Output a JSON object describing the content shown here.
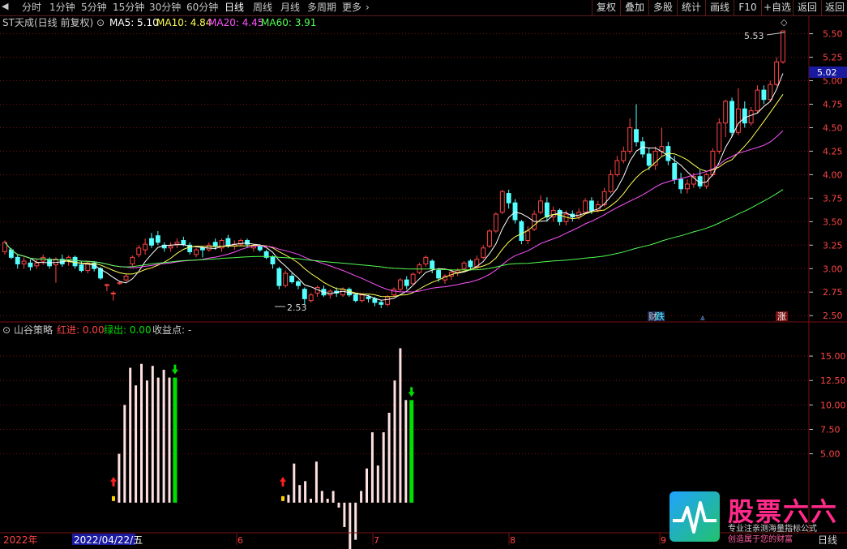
{
  "toolbar": {
    "nav_left_icon": "triangle-left-icon",
    "periods": [
      "分时",
      "1分钟",
      "5分钟",
      "15分钟",
      "30分钟",
      "60分钟",
      "日线",
      "周线",
      "月线",
      "多周期",
      "更多"
    ],
    "active_period": "日线",
    "more_icon": "chevron-right-icon",
    "buttons": [
      "复权",
      "叠加",
      "多股",
      "统计",
      "画线",
      "F10",
      "+自选",
      "返回"
    ]
  },
  "price_info": {
    "stock_title": "ST天成(日线 前复权)",
    "ma5": "MA5: 5.10",
    "ma10": "MA10: 4.84",
    "ma20": "MA20: 4.45",
    "ma60": "MA60: 3.91"
  },
  "price_axis": {
    "ticks": [
      "5.50",
      "5.25",
      "5.00",
      "4.75",
      "4.50",
      "4.25",
      "4.00",
      "3.75",
      "3.50",
      "3.25",
      "3.00",
      "2.75",
      "2.50"
    ],
    "current_price": "5.02",
    "high_label": "5.53",
    "low_label": "2.53"
  },
  "event_labels": {
    "cai": "财",
    "die": "跌",
    "zhang": "涨"
  },
  "indicator": {
    "name": "山谷策略",
    "red_in": "红进: 0.00",
    "green_out": "绿出: 0.00",
    "profit": "收益点: -",
    "ticks": [
      "15.00",
      "12.50",
      "10.00",
      "7.50",
      "5.00"
    ]
  },
  "time_axis": {
    "year": "2022年",
    "cursor_date": "2022/04/22/五",
    "months": [
      "6",
      "7",
      "8",
      "9"
    ]
  },
  "brand": {
    "name": "股票六六",
    "slogan1": "专业注亲测海量指标公式",
    "slogan2": "创造属于您的财富",
    "period": "日线"
  },
  "colors": {
    "up": "#ff4545",
    "down": "#54ffff",
    "ma5": "#ffffff",
    "ma10": "#ffff54",
    "ma20": "#ff54ff",
    "ma60": "#54ff54",
    "grid": "#7a1010",
    "signal_green": "#00e000"
  },
  "chart_data": {
    "type": "candlestick",
    "ylim": [
      2.45,
      5.6
    ],
    "candles": [
      [
        3.18,
        3.28,
        3.15,
        3.3
      ],
      [
        3.2,
        3.12,
        3.1,
        3.22
      ],
      [
        3.12,
        3.05,
        3.0,
        3.15
      ],
      [
        3.05,
        3.08,
        3.0,
        3.12
      ],
      [
        3.06,
        3.02,
        2.98,
        3.1
      ],
      [
        3.03,
        3.06,
        3.0,
        3.1
      ],
      [
        3.08,
        3.12,
        3.04,
        3.15
      ],
      [
        3.1,
        3.03,
        3.0,
        3.12
      ],
      [
        3.04,
        3.1,
        2.85,
        3.12
      ],
      [
        3.1,
        3.05,
        3.02,
        3.15
      ],
      [
        3.08,
        3.12,
        3.03,
        3.14
      ],
      [
        3.12,
        3.03,
        3.0,
        3.14
      ],
      [
        3.04,
        2.98,
        2.96,
        3.08
      ],
      [
        2.98,
        3.06,
        2.95,
        3.08
      ],
      [
        3.06,
        3.0,
        2.97,
        3.08
      ],
      [
        3.0,
        2.9,
        2.88,
        3.02
      ],
      [
        2.82,
        2.83,
        2.76,
        2.84
      ],
      [
        2.74,
        2.74,
        2.66,
        2.76
      ],
      [
        2.84,
        2.85,
        2.83,
        2.86
      ],
      [
        2.88,
        2.92,
        2.86,
        2.94
      ],
      [
        3.05,
        3.12,
        3.02,
        3.14
      ],
      [
        3.15,
        3.22,
        3.12,
        3.25
      ],
      [
        3.2,
        3.26,
        3.15,
        3.32
      ],
      [
        3.32,
        3.25,
        3.22,
        3.38
      ],
      [
        3.35,
        3.28,
        3.25,
        3.4
      ],
      [
        3.25,
        3.22,
        3.18,
        3.28
      ],
      [
        3.22,
        3.24,
        3.18,
        3.28
      ],
      [
        3.26,
        3.28,
        3.22,
        3.32
      ],
      [
        3.3,
        3.26,
        3.24,
        3.34
      ],
      [
        3.25,
        3.18,
        3.15,
        3.28
      ],
      [
        3.15,
        3.2,
        3.12,
        3.22
      ],
      [
        3.22,
        3.2,
        3.12,
        3.24
      ],
      [
        3.2,
        3.25,
        3.18,
        3.28
      ],
      [
        3.28,
        3.24,
        3.2,
        3.32
      ],
      [
        3.22,
        3.3,
        3.18,
        3.32
      ],
      [
        3.32,
        3.24,
        3.22,
        3.36
      ],
      [
        3.24,
        3.26,
        3.2,
        3.3
      ],
      [
        3.26,
        3.3,
        3.24,
        3.32
      ],
      [
        3.3,
        3.26,
        3.22,
        3.32
      ],
      [
        3.22,
        3.24,
        3.18,
        3.26
      ],
      [
        3.24,
        3.2,
        3.18,
        3.26
      ],
      [
        3.18,
        3.12,
        3.1,
        3.2
      ],
      [
        3.12,
        3.05,
        3.0,
        3.14
      ],
      [
        3.0,
        2.82,
        2.78,
        3.02
      ],
      [
        2.82,
        2.95,
        2.8,
        2.98
      ],
      [
        2.92,
        2.86,
        2.84,
        2.95
      ],
      [
        2.86,
        2.82,
        2.78,
        2.88
      ],
      [
        2.78,
        2.68,
        2.62,
        2.8
      ],
      [
        2.66,
        2.72,
        2.64,
        2.74
      ],
      [
        2.74,
        2.8,
        2.7,
        2.82
      ],
      [
        2.78,
        2.72,
        2.7,
        2.82
      ],
      [
        2.72,
        2.76,
        2.68,
        2.78
      ],
      [
        2.76,
        2.74,
        2.7,
        2.8
      ],
      [
        2.72,
        2.78,
        2.7,
        2.8
      ],
      [
        2.78,
        2.72,
        2.7,
        2.8
      ],
      [
        2.72,
        2.66,
        2.64,
        2.74
      ],
      [
        2.66,
        2.72,
        2.64,
        2.74
      ],
      [
        2.7,
        2.68,
        2.64,
        2.72
      ],
      [
        2.68,
        2.64,
        2.6,
        2.7
      ],
      [
        2.64,
        2.62,
        2.58,
        2.66
      ],
      [
        2.62,
        2.7,
        2.6,
        2.72
      ],
      [
        2.72,
        2.78,
        2.7,
        2.8
      ],
      [
        2.78,
        2.88,
        2.76,
        2.9
      ],
      [
        2.88,
        2.82,
        2.78,
        2.92
      ],
      [
        2.84,
        2.94,
        2.82,
        2.96
      ],
      [
        2.96,
        3.04,
        2.94,
        3.06
      ],
      [
        3.05,
        3.12,
        3.02,
        3.14
      ],
      [
        3.08,
        3.0,
        2.95,
        3.1
      ],
      [
        2.98,
        2.9,
        2.86,
        3.0
      ],
      [
        2.88,
        2.92,
        2.84,
        2.94
      ],
      [
        2.92,
        2.96,
        2.88,
        2.98
      ],
      [
        2.96,
        2.98,
        2.92,
        3.0
      ],
      [
        3.0,
        3.06,
        2.98,
        3.08
      ],
      [
        3.08,
        3.02,
        2.98,
        3.1
      ],
      [
        3.02,
        3.1,
        3.0,
        3.14
      ],
      [
        3.12,
        3.22,
        3.1,
        3.25
      ],
      [
        3.24,
        3.4,
        3.22,
        3.42
      ],
      [
        3.4,
        3.58,
        3.38,
        3.6
      ],
      [
        3.6,
        3.82,
        3.58,
        3.84
      ],
      [
        3.8,
        3.7,
        3.64,
        3.84
      ],
      [
        3.7,
        3.52,
        3.48,
        3.74
      ],
      [
        3.5,
        3.3,
        3.26,
        3.52
      ],
      [
        3.3,
        3.4,
        3.26,
        3.45
      ],
      [
        3.42,
        3.58,
        3.4,
        3.62
      ],
      [
        3.6,
        3.72,
        3.58,
        3.78
      ],
      [
        3.7,
        3.55,
        3.5,
        3.76
      ],
      [
        3.55,
        3.62,
        3.5,
        3.66
      ],
      [
        3.62,
        3.5,
        3.46,
        3.64
      ],
      [
        3.5,
        3.58,
        3.46,
        3.62
      ],
      [
        3.58,
        3.55,
        3.5,
        3.62
      ],
      [
        3.55,
        3.6,
        3.52,
        3.64
      ],
      [
        3.6,
        3.72,
        3.58,
        3.75
      ],
      [
        3.72,
        3.62,
        3.58,
        3.76
      ],
      [
        3.62,
        3.68,
        3.6,
        3.72
      ],
      [
        3.68,
        3.82,
        3.66,
        3.86
      ],
      [
        3.82,
        4.0,
        3.8,
        4.05
      ],
      [
        4.0,
        4.15,
        3.98,
        4.2
      ],
      [
        4.15,
        4.25,
        4.12,
        4.3
      ],
      [
        4.25,
        4.5,
        4.22,
        4.6
      ],
      [
        4.48,
        4.35,
        4.3,
        4.75
      ],
      [
        4.35,
        4.22,
        4.18,
        4.4
      ],
      [
        4.22,
        4.1,
        4.05,
        4.28
      ],
      [
        4.1,
        4.25,
        4.05,
        4.3
      ],
      [
        4.25,
        4.3,
        4.2,
        4.5
      ],
      [
        4.3,
        4.15,
        4.1,
        4.35
      ],
      [
        4.12,
        3.95,
        3.9,
        4.2
      ],
      [
        3.95,
        3.85,
        3.8,
        4.02
      ],
      [
        3.85,
        3.9,
        3.8,
        3.95
      ],
      [
        3.9,
        3.98,
        3.86,
        4.02
      ],
      [
        3.98,
        3.88,
        3.85,
        4.05
      ],
      [
        3.88,
        4.0,
        3.85,
        4.02
      ],
      [
        4.0,
        4.25,
        3.98,
        4.28
      ],
      [
        4.25,
        4.55,
        4.22,
        4.6
      ],
      [
        4.55,
        4.78,
        4.4,
        4.8
      ],
      [
        4.78,
        4.45,
        4.4,
        4.82
      ],
      [
        4.45,
        4.7,
        4.42,
        4.92
      ],
      [
        4.7,
        4.55,
        4.5,
        4.78
      ],
      [
        4.55,
        4.68,
        4.52,
        4.72
      ],
      [
        4.68,
        4.9,
        4.65,
        4.95
      ],
      [
        4.9,
        4.8,
        4.75,
        4.95
      ],
      [
        4.8,
        4.96,
        4.78,
        5.0
      ],
      [
        4.96,
        5.2,
        4.94,
        5.25
      ],
      [
        5.2,
        5.53,
        5.18,
        5.53
      ]
    ]
  },
  "indicator_data": {
    "ylim": [
      -3,
      17
    ],
    "group1": [
      1.0,
      5.0,
      10.0,
      13.8,
      12.0,
      14.2,
      12.5,
      14.0,
      12.8,
      13.6,
      12.8,
      12.8
    ],
    "group2": [
      5.0,
      0.8,
      4.0,
      1.8,
      2.2,
      0.4,
      4.2,
      1.2,
      0.4,
      1.2,
      -0.5,
      -2.5,
      -5.0,
      -3.8,
      1.2,
      3.5,
      7.2,
      3.8,
      7.2,
      9.2,
      12.5,
      15.8,
      10.5,
      10.5
    ]
  }
}
